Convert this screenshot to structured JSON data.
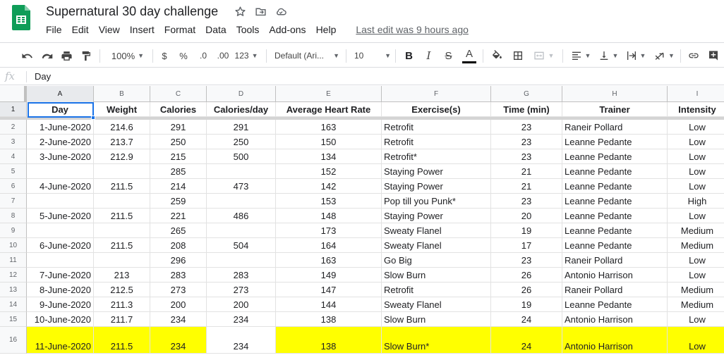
{
  "app": {
    "title": "Supernatural 30 day challenge",
    "icons": [
      "star-icon",
      "move-to-folder-icon",
      "cloud-status-icon"
    ]
  },
  "menu": {
    "items": [
      "File",
      "Edit",
      "View",
      "Insert",
      "Format",
      "Data",
      "Tools",
      "Add-ons",
      "Help"
    ],
    "last_edit": "Last edit was 9 hours ago"
  },
  "toolbar": {
    "zoom": "100%",
    "currency": "$",
    "percent": "%",
    "decrease_decimal": ".0",
    "increase_decimal": ".00",
    "more_formats": "123",
    "font": "Default (Ari...",
    "font_size": "10",
    "bold": "B",
    "italic": "I",
    "strikethrough": "S",
    "text_color": "A",
    "accent_bold_bg": "#e6f4ea"
  },
  "formula_bar": {
    "fx": "fx",
    "value": "Day"
  },
  "columns": [
    "A",
    "B",
    "C",
    "D",
    "E",
    "F",
    "G",
    "H",
    "I"
  ],
  "rows": [
    {
      "num": "1",
      "cells": [
        "Day",
        "Weight",
        "Calories",
        "Calories/day",
        "Average Heart Rate",
        "Exercise(s)",
        "Time (min)",
        "Trainer",
        "Intensity"
      ]
    },
    {
      "num": "2",
      "cells": [
        "1-June-2020",
        "214.6",
        "291",
        "291",
        "163",
        "Retrofit",
        "23",
        "Raneir Pollard",
        "Low"
      ]
    },
    {
      "num": "3",
      "cells": [
        "2-June-2020",
        "213.7",
        "250",
        "250",
        "150",
        "Retrofit",
        "23",
        "Leanne Pedante",
        "Low"
      ]
    },
    {
      "num": "4",
      "cells": [
        "3-June-2020",
        "212.9",
        "215",
        "500",
        "134",
        "Retrofit*",
        "23",
        "Leanne Pedante",
        "Low"
      ]
    },
    {
      "num": "5",
      "cells": [
        "",
        "",
        "285",
        "",
        "152",
        "Staying Power",
        "21",
        "Leanne Pedante",
        "Low"
      ]
    },
    {
      "num": "6",
      "cells": [
        "4-June-2020",
        "211.5",
        "214",
        "473",
        "142",
        "Staying Power",
        "21",
        "Leanne Pedante",
        "Low"
      ]
    },
    {
      "num": "7",
      "cells": [
        "",
        "",
        "259",
        "",
        "153",
        "Pop till you Punk*",
        "23",
        "Leanne Pedante",
        "High"
      ]
    },
    {
      "num": "8",
      "cells": [
        "5-June-2020",
        "211.5",
        "221",
        "486",
        "148",
        "Staying Power",
        "20",
        "Leanne Pedante",
        "Low"
      ]
    },
    {
      "num": "9",
      "cells": [
        "",
        "",
        "265",
        "",
        "173",
        "Sweaty Flanel",
        "19",
        "Leanne Pedante",
        "Medium"
      ]
    },
    {
      "num": "10",
      "cells": [
        "6-June-2020",
        "211.5",
        "208",
        "504",
        "164",
        "Sweaty Flanel",
        "17",
        "Leanne Pedante",
        "Medium"
      ]
    },
    {
      "num": "11",
      "cells": [
        "",
        "",
        "296",
        "",
        "163",
        "Go Big",
        "23",
        "Raneir Pollard",
        "Low"
      ]
    },
    {
      "num": "12",
      "cells": [
        "7-June-2020",
        "213",
        "283",
        "283",
        "149",
        "Slow Burn",
        "26",
        "Antonio Harrison",
        "Low"
      ]
    },
    {
      "num": "13",
      "cells": [
        "8-June-2020",
        "212.5",
        "273",
        "273",
        "147",
        "Retrofit",
        "26",
        "Raneir Pollard",
        "Medium"
      ]
    },
    {
      "num": "14",
      "cells": [
        "9-June-2020",
        "211.3",
        "200",
        "200",
        "144",
        "Sweaty Flanel",
        "19",
        "Leanne Pedante",
        "Medium"
      ]
    },
    {
      "num": "15",
      "cells": [
        "10-June-2020",
        "211.7",
        "234",
        "234",
        "138",
        "Slow Burn",
        "24",
        "Antonio Harrison",
        "Low"
      ]
    },
    {
      "num": "16",
      "cells": [
        "11-June-2020",
        "211.5",
        "234",
        "234",
        "138",
        "Slow Burn*",
        "24",
        "Antonio Harrison",
        "Low"
      ],
      "highlight": "#ffff00"
    }
  ]
}
